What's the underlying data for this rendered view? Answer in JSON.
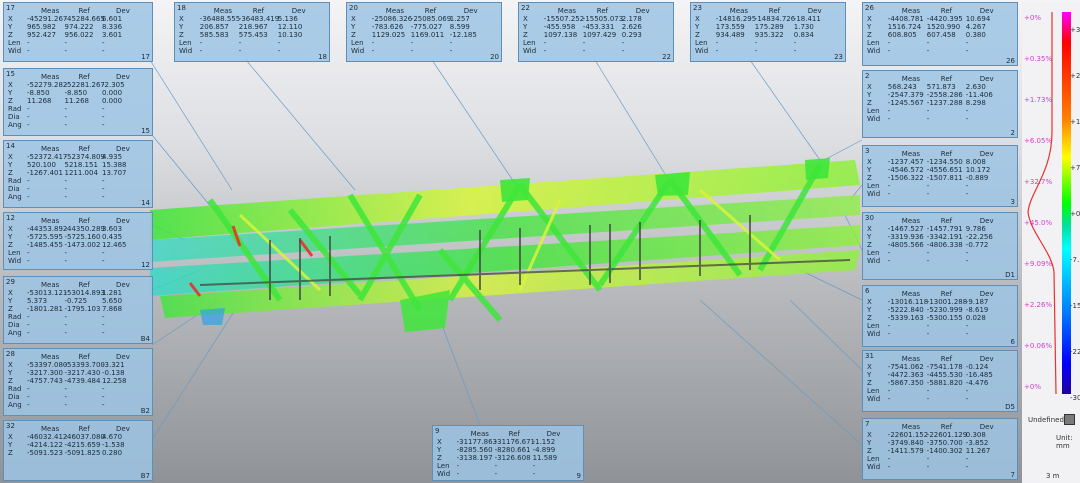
{
  "annotations": [
    {
      "id": "17",
      "suffix": "17",
      "hdr": [
        "Meas",
        "Ref",
        "Dev"
      ],
      "rows": [
        [
          "X",
          "-45291.267",
          "-45284.665",
          "6.601"
        ],
        [
          "Y",
          "965.982",
          "974.222",
          "8.336"
        ],
        [
          "Z",
          "952.427",
          "956.022",
          "3.601"
        ],
        [
          "Len",
          "-",
          "-",
          "-"
        ],
        [
          "Wid",
          "-",
          "-",
          "-"
        ]
      ]
    },
    {
      "id": "15",
      "suffix": "15",
      "hdr": [
        "Meas",
        "Ref",
        "Dev"
      ],
      "rows": [
        [
          "X",
          "-52279.282",
          "-52281.267",
          "-2.305"
        ],
        [
          "Y",
          "-8.850",
          "-8.850",
          "0.000"
        ],
        [
          "Z",
          "11.268",
          "11.268",
          "0.000"
        ],
        [
          "Rad",
          "-",
          "-",
          "-"
        ],
        [
          "Dia",
          "-",
          "-",
          "-"
        ],
        [
          "Ang",
          "-",
          "-",
          "-"
        ]
      ]
    },
    {
      "id": "14",
      "suffix": "14",
      "hdr": [
        "Meas",
        "Ref",
        "Dev"
      ],
      "rows": [
        [
          "X",
          "-52372.417",
          "-52374.809",
          "4.935"
        ],
        [
          "Y",
          "520.100",
          "5218.151",
          "15.388"
        ],
        [
          "Z",
          "-1267.401",
          "1211.004",
          "13.707"
        ],
        [
          "Rad",
          "-",
          "-",
          "-"
        ],
        [
          "Dia",
          "-",
          "-",
          "-"
        ],
        [
          "Ang",
          "-",
          "-",
          "-"
        ]
      ]
    },
    {
      "id": "12",
      "suffix": "12",
      "hdr": [
        "Meas",
        "Ref",
        "Dev"
      ],
      "rows": [
        [
          "X",
          "-44353.892",
          "-44350.289",
          "3.603"
        ],
        [
          "Y",
          "-5725.595",
          "-5725.160",
          "0.435"
        ],
        [
          "Z",
          "-1485.455",
          "-1473.002",
          "12.465"
        ],
        [
          "Len",
          "-",
          "-",
          "-"
        ],
        [
          "Wid",
          "-",
          "-",
          "-"
        ]
      ]
    },
    {
      "id": "29",
      "suffix": "B4",
      "hdr": [
        "Meas",
        "Ref",
        "Dev"
      ],
      "rows": [
        [
          "X",
          "-53013.121",
          "-53014.893",
          "1.281"
        ],
        [
          "Y",
          "5.373",
          "-0.725",
          "5.650"
        ],
        [
          "Z",
          "-1801.281",
          "-1795.103",
          "7.868"
        ],
        [
          "Rad",
          "-",
          "-",
          "-"
        ],
        [
          "Dia",
          "-",
          "-",
          "-"
        ],
        [
          "Ang",
          "-",
          "-",
          "-"
        ]
      ]
    },
    {
      "id": "28",
      "suffix": "B2",
      "hdr": [
        "Meas",
        "Ref",
        "Dev"
      ],
      "rows": [
        [
          "X",
          "-53397.080",
          "-53393.700",
          "-3.321"
        ],
        [
          "Y",
          "-3217.300",
          "-3217.430",
          "-0.138"
        ],
        [
          "Z",
          "-4757.743",
          "-4739.484",
          "12.258"
        ],
        [
          "Rad",
          "-",
          "-",
          "-"
        ],
        [
          "Dia",
          "-",
          "-",
          "-"
        ],
        [
          "Ang",
          "-",
          "-",
          "-"
        ]
      ]
    },
    {
      "id": "32",
      "suffix": "B7",
      "hdr": [
        "Meas",
        "Ref",
        "Dev"
      ],
      "rows": [
        [
          "X",
          "-46032.412",
          "-46037.080",
          "4.670"
        ],
        [
          "Y",
          "-4214.122",
          "-4215.659",
          "-1.538"
        ],
        [
          "Z",
          "-5091.523",
          "-5091.825",
          "0.280"
        ]
      ]
    },
    {
      "id": "18",
      "suffix": "18",
      "hdr": [
        "Meas",
        "Ref",
        "Dev"
      ],
      "rows": [
        [
          "X",
          "-36488.555",
          "-36483.419",
          "5.136"
        ],
        [
          "Y",
          "206.857",
          "218.967",
          "12.110"
        ],
        [
          "Z",
          "585.583",
          "575.453",
          "10.130"
        ],
        [
          "Len",
          "-",
          "-",
          "-"
        ],
        [
          "Wid",
          "-",
          "-",
          "-"
        ]
      ]
    },
    {
      "id": "20",
      "suffix": "20",
      "hdr": [
        "Meas",
        "Ref",
        "Dev"
      ],
      "rows": [
        [
          "X",
          "-25086.326",
          "-25085.069",
          "1.257"
        ],
        [
          "Y",
          "-783.626",
          "-775.027",
          "8.599"
        ],
        [
          "Z",
          "1129.025",
          "1169.011",
          "-12.185"
        ],
        [
          "Len",
          "-",
          "-",
          "-"
        ],
        [
          "Wid",
          "-",
          "-",
          "-"
        ]
      ]
    },
    {
      "id": "22",
      "suffix": "22",
      "hdr": [
        "Meas",
        "Ref",
        "Dev"
      ],
      "rows": [
        [
          "X",
          "-15507.252",
          "-15505.073",
          "2.178"
        ],
        [
          "Y",
          "-455.958",
          "-453.331",
          "2.626"
        ],
        [
          "Z",
          "1097.138",
          "1097.429",
          "0.293"
        ],
        [
          "Len",
          "-",
          "-",
          "-"
        ],
        [
          "Wid",
          "-",
          "-",
          "-"
        ]
      ]
    },
    {
      "id": "23",
      "suffix": "23",
      "hdr": [
        "Meas",
        "Ref",
        "Dev"
      ],
      "rows": [
        [
          "X",
          "-14816.295",
          "-14834.726",
          "-18.411"
        ],
        [
          "Y",
          "173.559",
          "175.289",
          "1.730"
        ],
        [
          "Z",
          "934.489",
          "935.322",
          "0.834"
        ],
        [
          "Len",
          "-",
          "-",
          "-"
        ],
        [
          "Wid",
          "-",
          "-",
          "-"
        ]
      ]
    },
    {
      "id": "26",
      "suffix": "26",
      "hdr": [
        "Meas",
        "Ref",
        "Dev"
      ],
      "rows": [
        [
          "X",
          "-4408.781",
          "-4420.395",
          "10.694"
        ],
        [
          "Y",
          "1516.724",
          "1520.990",
          "4.267"
        ],
        [
          "Z",
          "608.805",
          "607.458",
          "0.380"
        ],
        [
          "Len",
          "-",
          "-",
          "-"
        ],
        [
          "Wid",
          "-",
          "-",
          "-"
        ]
      ]
    },
    {
      "id": "2",
      "suffix": "2",
      "hdr": [
        "Meas",
        "Ref",
        "Dev"
      ],
      "rows": [
        [
          "X",
          "568.243",
          "571.873",
          "2.630"
        ],
        [
          "Y",
          "-2547.379",
          "-2558.286",
          "-11.406"
        ],
        [
          "Z",
          "-1245.567",
          "-1237.288",
          "8.298"
        ],
        [
          "Len",
          "-",
          "-",
          "-"
        ],
        [
          "Wid",
          "-",
          "-",
          "-"
        ]
      ]
    },
    {
      "id": "3",
      "suffix": "3",
      "hdr": [
        "Meas",
        "Ref",
        "Dev"
      ],
      "rows": [
        [
          "X",
          "-1237.457",
          "-1234.550",
          "8.008"
        ],
        [
          "Y",
          "-4546.572",
          "-4556.651",
          "10.172"
        ],
        [
          "Z",
          "-1506.322",
          "-1507.811",
          "-0.889"
        ],
        [
          "Len",
          "-",
          "-",
          "-"
        ],
        [
          "Wid",
          "-",
          "-",
          "-"
        ]
      ]
    },
    {
      "id": "30",
      "suffix": "D1",
      "hdr": [
        "Meas",
        "Ref",
        "Dev"
      ],
      "rows": [
        [
          "X",
          "-1467.527",
          "-1457.791",
          "9.786"
        ],
        [
          "Y",
          "-3319.936",
          "-3342.191",
          "-22.256"
        ],
        [
          "Z",
          "-4805.566",
          "-4806.338",
          "-0.772"
        ],
        [
          "Len",
          "-",
          "-",
          "-"
        ],
        [
          "Wid",
          "-",
          "-",
          "-"
        ]
      ]
    },
    {
      "id": "6",
      "suffix": "6",
      "hdr": [
        "Meas",
        "Ref",
        "Dev"
      ],
      "rows": [
        [
          "X",
          "-13016.118",
          "-13001.288",
          "-9.187"
        ],
        [
          "Y",
          "-5222.840",
          "-5230.999",
          "-8.619"
        ],
        [
          "Z",
          "-5339.163",
          "-5300.155",
          "0.028"
        ],
        [
          "Len",
          "-",
          "-",
          "-"
        ],
        [
          "Wid",
          "-",
          "-",
          "-"
        ]
      ]
    },
    {
      "id": "31",
      "suffix": "D5",
      "hdr": [
        "Meas",
        "Ref",
        "Dev"
      ],
      "rows": [
        [
          "X",
          "-7541.062",
          "-7541.178",
          "-0.124"
        ],
        [
          "Y",
          "-4472.363",
          "-4455.530",
          "-16.485"
        ],
        [
          "Z",
          "-5867.350",
          "-5881.820",
          "-4.476"
        ],
        [
          "Len",
          "-",
          "-",
          "-"
        ],
        [
          "Wid",
          "-",
          "-",
          "-"
        ]
      ]
    },
    {
      "id": "7",
      "suffix": "7",
      "hdr": [
        "Meas",
        "Ref",
        "Dev"
      ],
      "rows": [
        [
          "X",
          "-22601.152",
          "-22601.129",
          "0.308"
        ],
        [
          "Y",
          "-3749.840",
          "-3750.700",
          "-3.852"
        ],
        [
          "Z",
          "-1411.579",
          "-1400.302",
          "11.267"
        ],
        [
          "Len",
          "-",
          "-",
          "-"
        ],
        [
          "Wid",
          "-",
          "-",
          "-"
        ]
      ]
    },
    {
      "id": "9",
      "suffix": "9",
      "hdr": [
        "Meas",
        "Ref",
        "Dev"
      ],
      "rows": [
        [
          "X",
          "-31177.863",
          "-31176.671",
          "-1.152"
        ],
        [
          "Y",
          "-8285.560",
          "-8280.661",
          "-4.899"
        ],
        [
          "Z",
          "-3138.197",
          "-3126.608",
          "11.589"
        ],
        [
          "Len",
          "-",
          "-",
          "-"
        ],
        [
          "Wid",
          "-",
          "-",
          "-"
        ]
      ]
    }
  ],
  "scale": {
    "ticks": [
      "+30",
      "+22.5",
      "+15",
      "+7.5",
      "+0",
      "-7.5",
      "-15",
      "-22.5",
      "-30"
    ],
    "percents": [
      "+0%",
      "+0.35%",
      "+1.73%",
      "+6.05%",
      "+32.7%",
      "+45.0%",
      "+9.09%",
      "+2.26%",
      "+0.06%",
      "+0%"
    ],
    "undefined_label": "Undefined",
    "unit_label": "Unit: mm",
    "small_scale": "3 m"
  },
  "colors": {
    "panel": "#9cc4e4",
    "panel_border": "#5f8fb6",
    "leader": "#5f8fb6",
    "truss_green": "#3ee63a",
    "truss_yellow": "#d8f53a",
    "truss_cyan": "#33d9c8",
    "truss_red": "#e8322a"
  }
}
